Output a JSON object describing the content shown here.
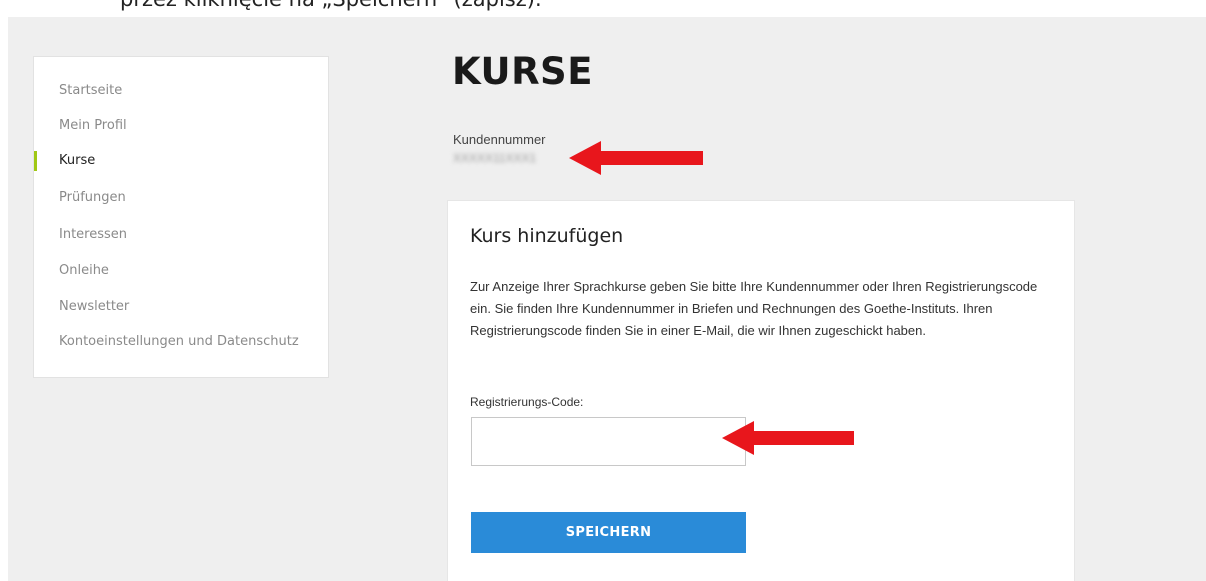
{
  "caption": "przez kliknięcie na „Speichern” (zapisz).",
  "sidebar": {
    "items": [
      {
        "label": "Startseite"
      },
      {
        "label": "Mein Profil"
      },
      {
        "label": "Kurse"
      },
      {
        "label": "Prüfungen"
      },
      {
        "label": "Interessen"
      },
      {
        "label": "Onleihe"
      },
      {
        "label": "Newsletter"
      },
      {
        "label": "Kontoeinstellungen und Datenschutz"
      }
    ],
    "active": "Kurse"
  },
  "main": {
    "title": "KURSE",
    "customer_number_label": "Kundennummer",
    "customer_number_value": "XXXXX11XXX1"
  },
  "card": {
    "heading": "Kurs hinzufügen",
    "description": "Zur Anzeige Ihrer Sprachkurse geben Sie bitte Ihre Kundennummer oder Ihren Registrierungscode ein. Sie finden Ihre Kundennummer in Briefen und Rechnungen des Goethe-Instituts. Ihren Registrierungscode finden Sie in einer E-Mail, die wir Ihnen zugeschickt haben.",
    "field_label": "Registrierungs-Code:",
    "field_value": "",
    "save_label": "SPEICHERN"
  },
  "colors": {
    "accent": "#2a8bd8",
    "active_marker": "#a0c814",
    "annotation_arrow": "#e8161c"
  },
  "annotations": [
    {
      "name": "arrow-to-customer-number",
      "icon": "left-arrow"
    },
    {
      "name": "arrow-to-code-input",
      "icon": "left-arrow"
    }
  ]
}
